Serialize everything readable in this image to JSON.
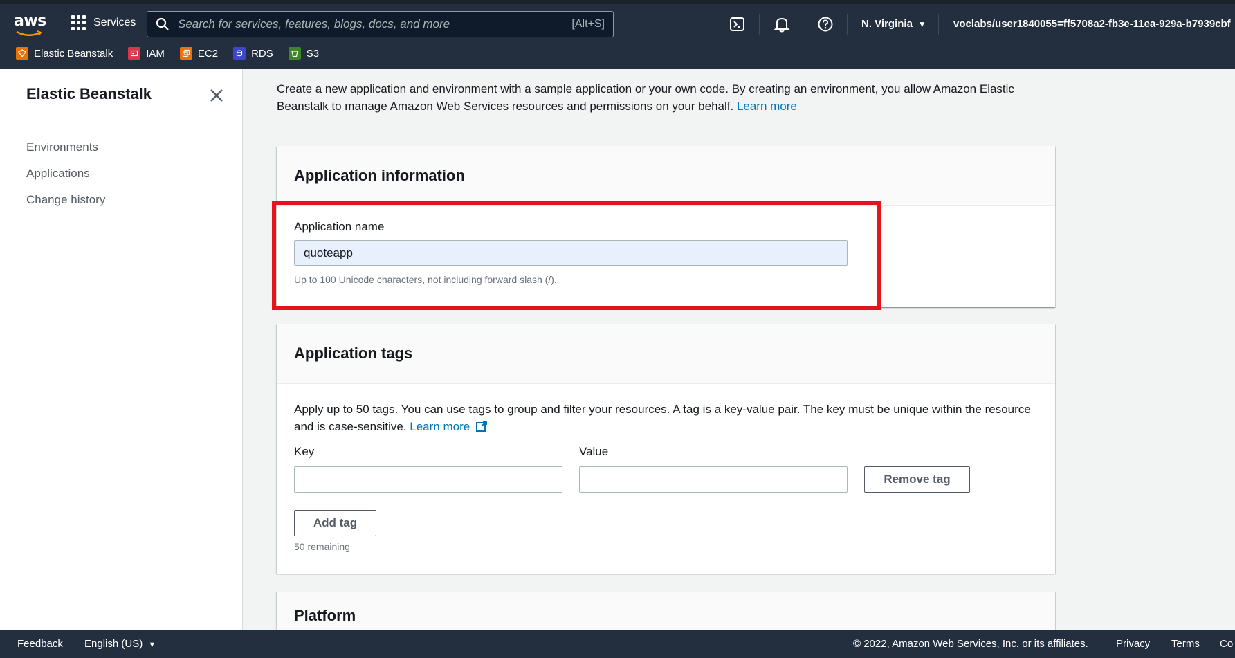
{
  "topbar": {
    "logo_text": "aws",
    "services_label": "Services",
    "search_placeholder": "Search for services, features, blogs, docs, and more",
    "search_shortcut": "[Alt+S]",
    "region": "N. Virginia",
    "account": "voclabs/user1840055=ff5708a2-fb3e-11ea-929a-b7939cbf",
    "favorites": [
      {
        "label": "Elastic Beanstalk",
        "icon": "elastic-beanstalk-icon",
        "color": "#ed7100"
      },
      {
        "label": "IAM",
        "icon": "iam-icon",
        "color": "#dd344c"
      },
      {
        "label": "EC2",
        "icon": "ec2-icon",
        "color": "#ed7100"
      },
      {
        "label": "RDS",
        "icon": "rds-icon",
        "color": "#3b48cc"
      },
      {
        "label": "S3",
        "icon": "s3-icon",
        "color": "#3f8624"
      }
    ]
  },
  "sidebar": {
    "title": "Elastic Beanstalk",
    "items": [
      {
        "label": "Environments"
      },
      {
        "label": "Applications"
      },
      {
        "label": "Change history"
      }
    ]
  },
  "main": {
    "intro_text": "Create a new application and environment with a sample application or your own code. By creating an environment, you allow Amazon Elastic Beanstalk to manage Amazon Web Services resources and permissions on your behalf.",
    "intro_link": "Learn more",
    "app_info": {
      "title": "Application information",
      "name_label": "Application name",
      "name_value": "quoteapp",
      "name_hint": "Up to 100 Unicode characters, not including forward slash (/)."
    },
    "app_tags": {
      "title": "Application tags",
      "description": "Apply up to 50 tags. You can use tags to group and filter your resources. A tag is a key-value pair. The key must be unique within the resource and is case-sensitive.",
      "learn_more": "Learn more",
      "key_label": "Key",
      "value_label": "Value",
      "key_value": "",
      "value_value": "",
      "remove_tag": "Remove tag",
      "add_tag": "Add tag",
      "remaining": "50 remaining"
    },
    "platform": {
      "title": "Platform"
    }
  },
  "footer": {
    "feedback": "Feedback",
    "language": "English (US)",
    "copyright": "© 2022, Amazon Web Services, Inc. or its affiliates.",
    "privacy": "Privacy",
    "terms": "Terms",
    "cookie": "Co"
  },
  "colors": {
    "topbar_bg": "#232f3e",
    "link": "#0073bb",
    "highlight": "#e3141c",
    "input_fill": "#e8f0fe"
  }
}
